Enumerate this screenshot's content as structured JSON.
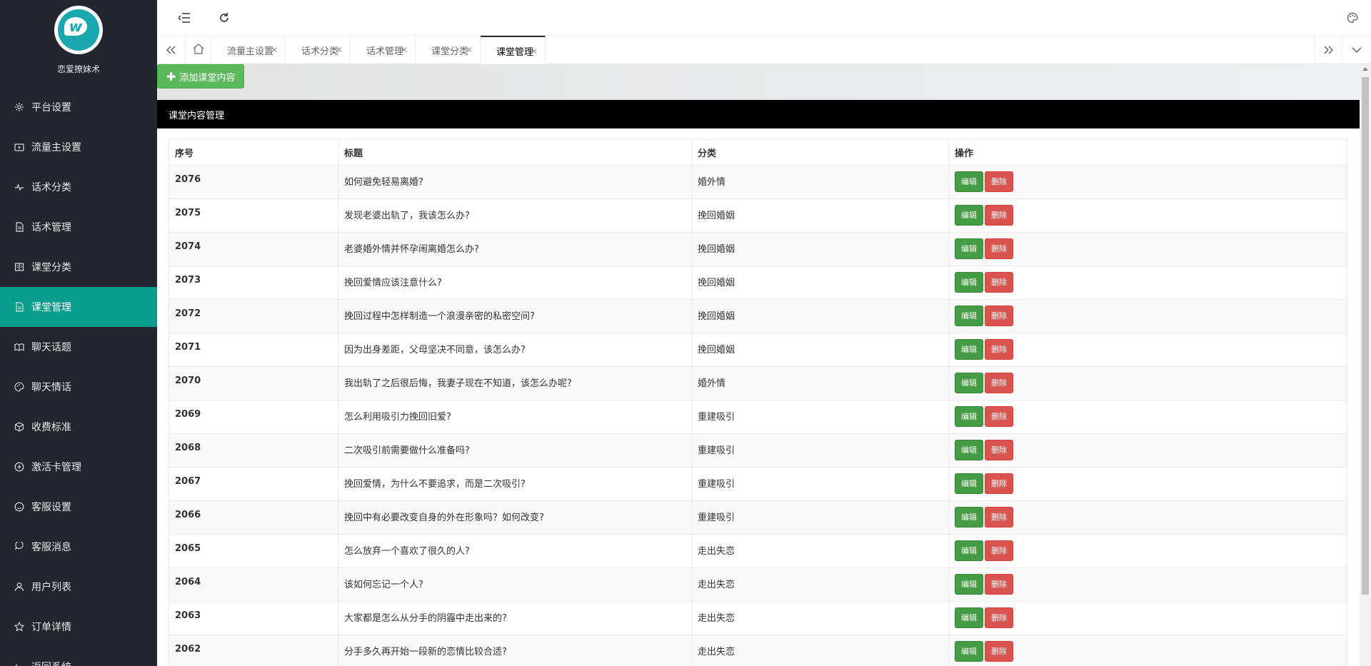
{
  "sidebar": {
    "logo_text": "恋爱撩妹术",
    "items": [
      {
        "label": "平台设置",
        "icon": "gear-icon"
      },
      {
        "label": "流量主设置",
        "icon": "video-icon"
      },
      {
        "label": "话术分类",
        "icon": "pulse-icon"
      },
      {
        "label": "话术管理",
        "icon": "document-icon"
      },
      {
        "label": "课堂分类",
        "icon": "book-icon"
      },
      {
        "label": "课堂管理",
        "icon": "document-icon",
        "active": true
      },
      {
        "label": "聊天话题",
        "icon": "reading-icon"
      },
      {
        "label": "聊天情话",
        "icon": "palette-icon"
      },
      {
        "label": "收费标准",
        "icon": "cube-icon"
      },
      {
        "label": "激活卡管理",
        "icon": "plus-circle-icon"
      },
      {
        "label": "客服设置",
        "icon": "smile-icon"
      },
      {
        "label": "客服消息",
        "icon": "chat-icon"
      },
      {
        "label": "用户列表",
        "icon": "user-icon"
      },
      {
        "label": "订单详情",
        "icon": "star-icon"
      },
      {
        "label": "返回系统",
        "icon": "return-icon"
      }
    ]
  },
  "tabs": [
    {
      "label": "流量主设置"
    },
    {
      "label": "话术分类"
    },
    {
      "label": "话术管理"
    },
    {
      "label": "课堂分类"
    },
    {
      "label": "课堂管理",
      "active": true
    }
  ],
  "toolbar": {
    "add_label": "添加课堂内容"
  },
  "panel": {
    "title": "课堂内容管理"
  },
  "table": {
    "headers": {
      "id": "序号",
      "title": "标题",
      "category": "分类",
      "actions": "操作"
    },
    "edit_label": "编辑",
    "delete_label": "删除",
    "rows": [
      {
        "id": "2076",
        "title": "如何避免轻易离婚?",
        "category": "婚外情"
      },
      {
        "id": "2075",
        "title": "发现老婆出轨了，我该怎么办?",
        "category": "挽回婚姻"
      },
      {
        "id": "2074",
        "title": "老婆婚外情并怀孕闹离婚怎么办?",
        "category": "挽回婚姻"
      },
      {
        "id": "2073",
        "title": "挽回爱情应该注意什么?",
        "category": "挽回婚姻"
      },
      {
        "id": "2072",
        "title": "挽回过程中怎样制造一个浪漫亲密的私密空间?",
        "category": "挽回婚姻"
      },
      {
        "id": "2071",
        "title": "因为出身差距，父母坚决不同意，该怎么办?",
        "category": "挽回婚姻"
      },
      {
        "id": "2070",
        "title": "我出轨了之后很后悔，我妻子现在不知道，该怎么办呢?",
        "category": "婚外情"
      },
      {
        "id": "2069",
        "title": "怎么利用吸引力挽回旧爱?",
        "category": "重建吸引"
      },
      {
        "id": "2068",
        "title": "二次吸引前需要做什么准备吗?",
        "category": "重建吸引"
      },
      {
        "id": "2067",
        "title": "挽回爱情，为什么不要追求，而是二次吸引?",
        "category": "重建吸引"
      },
      {
        "id": "2066",
        "title": "挽回中有必要改变自身的外在形象吗？如何改变?",
        "category": "重建吸引"
      },
      {
        "id": "2065",
        "title": "怎么放弃一个喜欢了很久的人?",
        "category": "走出失恋"
      },
      {
        "id": "2064",
        "title": "该如何忘记一个人?",
        "category": "走出失恋"
      },
      {
        "id": "2063",
        "title": "大家都是怎么从分手的阴霾中走出来的?",
        "category": "走出失恋"
      },
      {
        "id": "2062",
        "title": "分手多久再开始一段新的恋情比较合适?",
        "category": "走出失恋"
      }
    ]
  }
}
